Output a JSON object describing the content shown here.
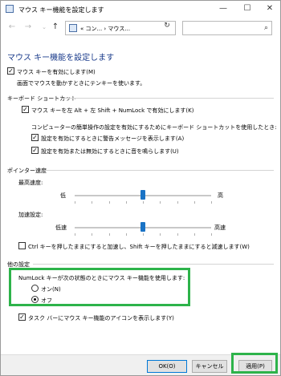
{
  "window": {
    "title": "マウス キー機能を設定します",
    "min_glyph": "—",
    "max_glyph": "☐",
    "close_glyph": "✕"
  },
  "nav": {
    "back_glyph": "←",
    "forward_glyph": "→",
    "up_glyph": "↑",
    "breadcrumb": "«  コン...  ›  マウス...",
    "caret_glyph": "⌄",
    "refresh_glyph": "↻",
    "search_placeholder": "",
    "search_glyph": "⌕"
  },
  "page": {
    "title": "マウス キー機能を設定します"
  },
  "options": {
    "enable_mouse_keys": {
      "label": "マウス キーを有効にします(M)",
      "checked": true
    },
    "enable_desc": "画面でマウスを動かすときにテンキーを使います。"
  },
  "shortcut": {
    "section": "キーボード ショートカット",
    "alt_shift_numlock": {
      "label": "マウス キーを左 Alt + 左 Shift + NumLock で有効にします(K)",
      "checked": true
    },
    "ease_desc": "コンピューターの簡単操作の設定を有効にするためにキーボード ショートカットを使用したとき:",
    "warning_msg": {
      "label": "設定を有効にするときに警告メッセージを表示します(A)",
      "checked": true
    },
    "sound": {
      "label": "設定を有効または無効にするときに音を鳴らします(U)",
      "checked": true
    }
  },
  "pointer_speed": {
    "section": "ポインター速度",
    "top_speed_label": "最高速度:",
    "top_low": "低",
    "top_high": "高",
    "top_value": 0.5,
    "accel_label": "加速設定:",
    "accel_low": "低速",
    "accel_high": "高速",
    "accel_value": 0.5,
    "ctrl_shift": {
      "label": "Ctrl キーを押したままにすると加速し、Shift キーを押したままにすると減速します(W)",
      "checked": false
    }
  },
  "other": {
    "section": "他の設定",
    "numlock_desc": "NumLock キーが次の状態のときにマウス キー機能を使用します:",
    "on_label": "オン(N)",
    "off_label": "オフ",
    "selected": "off",
    "taskbar_icon": {
      "label": "タスク バーにマウス キー機能のアイコンを表示します(Y)",
      "checked": true
    }
  },
  "footer": {
    "ok": "OK(O)",
    "cancel": "キャンセル",
    "apply": "適用(P)"
  },
  "colors": {
    "highlight": "#2db34a",
    "title": "#1a3b8b",
    "slider_thumb": "#1a73c5"
  }
}
